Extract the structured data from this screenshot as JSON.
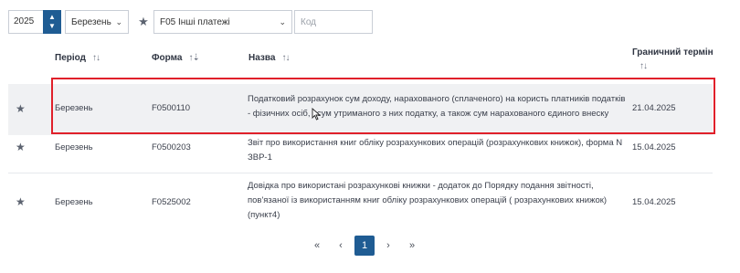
{
  "filters": {
    "year": "2025",
    "month": "Березень",
    "form": "F05 Інші платежі",
    "code_placeholder": "Код"
  },
  "table": {
    "headers": {
      "period": "Період",
      "form": "Форма",
      "name": "Назва",
      "deadline_line1": "Граничний термін"
    },
    "rows": [
      {
        "period": "Березень",
        "form": "F0500110",
        "name": "Податковий розрахунок сум доходу, нарахованого (сплаченого) на користь платників податків - фізичних осіб, і сум утриманого з них податку, а також сум нарахованого єдиного внеску",
        "deadline": "21.04.2025"
      },
      {
        "period": "Березень",
        "form": "F0500203",
        "name": "Звіт про використання книг обліку розрахункових операцій (розрахункових книжок), форма N ЗВР-1",
        "deadline": "15.04.2025"
      },
      {
        "period": "Березень",
        "form": "F0525002",
        "name": "Довідка про використані розрахункові книжки - додаток до Порядку подання звітності, пов'язаної із використанням книг обліку розрахункових операцій ( розрахункових книжок) (пункт4)",
        "deadline": "15.04.2025"
      }
    ]
  },
  "pagination": {
    "first": "«",
    "prev": "‹",
    "current": "1",
    "next": "›",
    "last": "»"
  },
  "colors": {
    "accent": "#1f5c93",
    "highlight": "#e0202a",
    "selected_row_bg": "#f0f1f3"
  }
}
